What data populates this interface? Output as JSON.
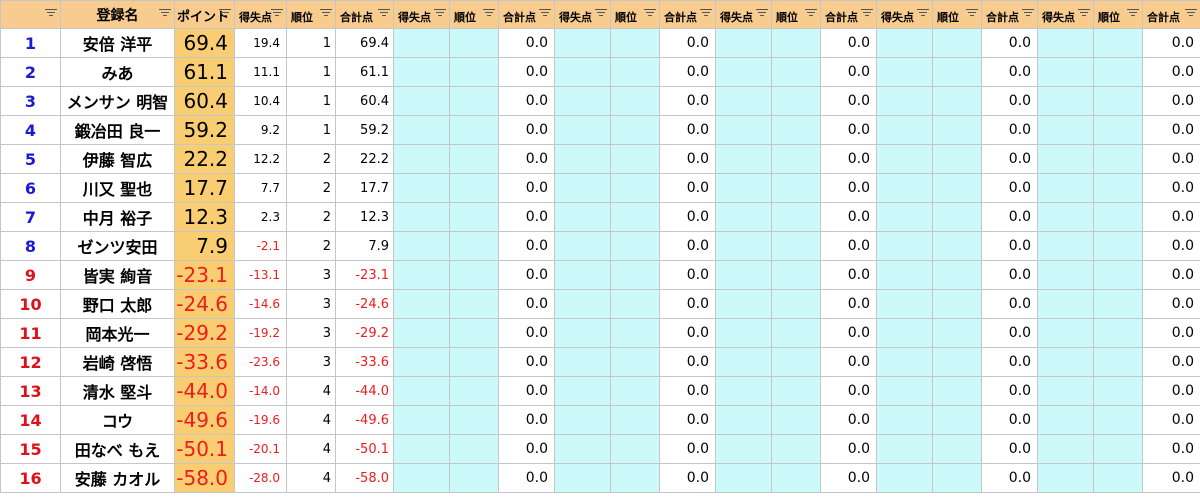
{
  "headers": {
    "index_col": "",
    "name_col": "登録名",
    "points_col": "ポイント",
    "score": "得失点",
    "rank": "順位",
    "sum": "合計点"
  },
  "rows": [
    {
      "idx": "1",
      "name": "安倍 洋平",
      "total": "69.4",
      "score": "19.4",
      "rank": "1",
      "sum": "69.4",
      "neg": false
    },
    {
      "idx": "2",
      "name": "みあ",
      "total": "61.1",
      "score": "11.1",
      "rank": "1",
      "sum": "61.1",
      "neg": false
    },
    {
      "idx": "3",
      "name": "メンサン 明智",
      "total": "60.4",
      "score": "10.4",
      "rank": "1",
      "sum": "60.4",
      "neg": false
    },
    {
      "idx": "4",
      "name": "鍛冶田 良一",
      "total": "59.2",
      "score": "9.2",
      "rank": "1",
      "sum": "59.2",
      "neg": false
    },
    {
      "idx": "5",
      "name": "伊藤 智広",
      "total": "22.2",
      "score": "12.2",
      "rank": "2",
      "sum": "22.2",
      "neg": false
    },
    {
      "idx": "6",
      "name": "川又 聖也",
      "total": "17.7",
      "score": "7.7",
      "rank": "2",
      "sum": "17.7",
      "neg": false
    },
    {
      "idx": "7",
      "name": "中月 裕子",
      "total": "12.3",
      "score": "2.3",
      "rank": "2",
      "sum": "12.3",
      "neg": false
    },
    {
      "idx": "8",
      "name": "ゼンツ安田",
      "total": "7.9",
      "score": "-2.1",
      "rank": "2",
      "sum": "7.9",
      "neg": false,
      "score_neg": true
    },
    {
      "idx": "9",
      "name": "皆実 絢音",
      "total": "-23.1",
      "score": "-13.1",
      "rank": "3",
      "sum": "-23.1",
      "neg": true
    },
    {
      "idx": "10",
      "name": "野口 太郎",
      "total": "-24.6",
      "score": "-14.6",
      "rank": "3",
      "sum": "-24.6",
      "neg": true
    },
    {
      "idx": "11",
      "name": "岡本光一",
      "total": "-29.2",
      "score": "-19.2",
      "rank": "3",
      "sum": "-29.2",
      "neg": true
    },
    {
      "idx": "12",
      "name": "岩崎 啓悟",
      "total": "-33.6",
      "score": "-23.6",
      "rank": "3",
      "sum": "-33.6",
      "neg": true
    },
    {
      "idx": "13",
      "name": "清水 堅斗",
      "total": "-44.0",
      "score": "-14.0",
      "rank": "4",
      "sum": "-44.0",
      "neg": true
    },
    {
      "idx": "14",
      "name": "コウ",
      "total": "-49.6",
      "score": "-19.6",
      "rank": "4",
      "sum": "-49.6",
      "neg": true
    },
    {
      "idx": "15",
      "name": "田なべ もえ",
      "total": "-50.1",
      "score": "-20.1",
      "rank": "4",
      "sum": "-50.1",
      "neg": true
    },
    {
      "idx": "16",
      "name": "安藤 カオル",
      "total": "-58.0",
      "score": "-28.0",
      "rank": "4",
      "sum": "-58.0",
      "neg": true
    }
  ],
  "empty_sum_value": "0.0",
  "empty_round_count": 5,
  "colors": {
    "header_bg": "#f8cb8f",
    "points_bg": "#f9cd72",
    "cyan_bg": "#ccfafa",
    "index_blue": "#1a1ad1",
    "negative_red": "#ee1c1c"
  }
}
